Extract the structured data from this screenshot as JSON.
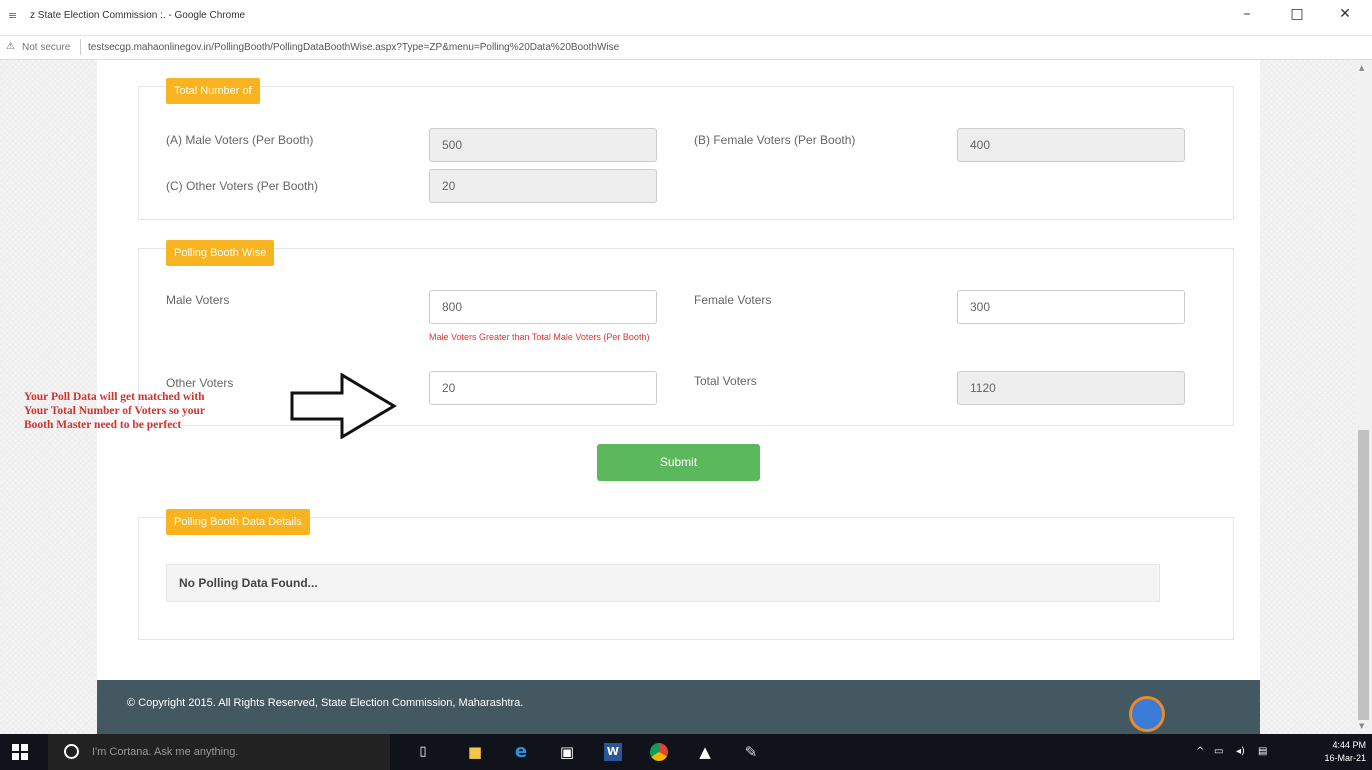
{
  "browser": {
    "tab_title": "z State Election Commission :. - Google Chrome",
    "not_secure": "Not secure",
    "url": "testsecgp.mahaonlinegov.in/PollingBooth/PollingDataBoothWise.aspx?Type=ZP&menu=Polling%20Data%20BoothWise",
    "minimize": "–",
    "maximize": "□",
    "close": "✕"
  },
  "total_section": {
    "legend": "Total Number of",
    "male_label": "(A) Male Voters (Per Booth)",
    "male_value": "500",
    "female_label": "(B) Female Voters (Per Booth)",
    "female_value": "400",
    "other_label": "(C) Other Voters (Per Booth)",
    "other_value": "20"
  },
  "booth_section": {
    "legend": "Polling Booth Wise",
    "male_label": "Male Voters",
    "male_value": "800",
    "male_error": "Male Voters Greater than Total Male Voters (Per Booth)",
    "female_label": "Female Voters",
    "female_value": "300",
    "other_label": "Other Voters",
    "other_value": "20",
    "total_label": "Total Voters",
    "total_value": "1120"
  },
  "submit_label": "Submit",
  "details_section": {
    "legend": "Polling Booth Data Details",
    "empty_message": "No Polling Data Found..."
  },
  "footer": {
    "copyright": "© Copyright 2015. All Rights Reserved, State Election Commission, Maharashtra."
  },
  "annotation": {
    "line1": "Your Poll Data will get matched with",
    "line2": "Your Total Number of Voters so your",
    "line3": "Booth Master need to be perfect"
  },
  "taskbar": {
    "search_placeholder": "I'm Cortana. Ask me anything.",
    "time": "4:44 PM",
    "date": "16-Mar-21",
    "icons": [
      "windows-start-icon",
      "task-view-icon",
      "file-explorer-icon",
      "edge-icon",
      "store-icon",
      "word-icon",
      "chrome-icon",
      "photos-icon",
      "paint-icon"
    ]
  }
}
